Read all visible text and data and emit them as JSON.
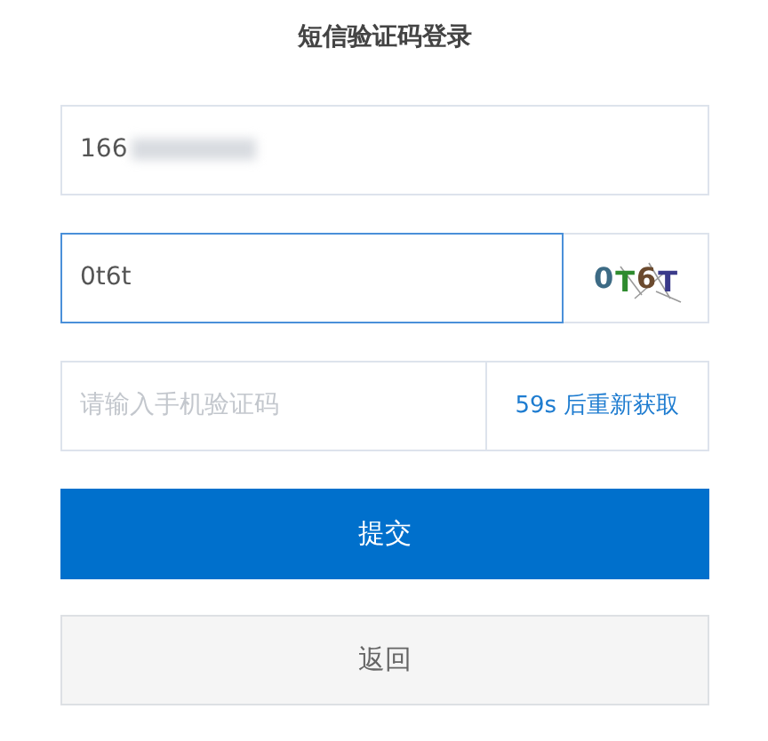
{
  "title": "短信验证码登录",
  "phone_field": {
    "value": "166",
    "redacted": true
  },
  "captcha_field": {
    "value": "0t6t",
    "focused": true
  },
  "captcha_image": {
    "chars": [
      {
        "text": "0",
        "color": "#3d6b85"
      },
      {
        "text": "T",
        "color": "#2e8b2e"
      },
      {
        "text": "6",
        "color": "#6b4a2e"
      },
      {
        "text": "T",
        "color": "#3a3a8a"
      }
    ]
  },
  "sms_field": {
    "placeholder": "请输入手机验证码"
  },
  "resend_button": {
    "label": "59s 后重新获取"
  },
  "buttons": [
    {
      "label": "提交",
      "kind": "primary"
    },
    {
      "label": "返回",
      "kind": "secondary"
    }
  ]
}
